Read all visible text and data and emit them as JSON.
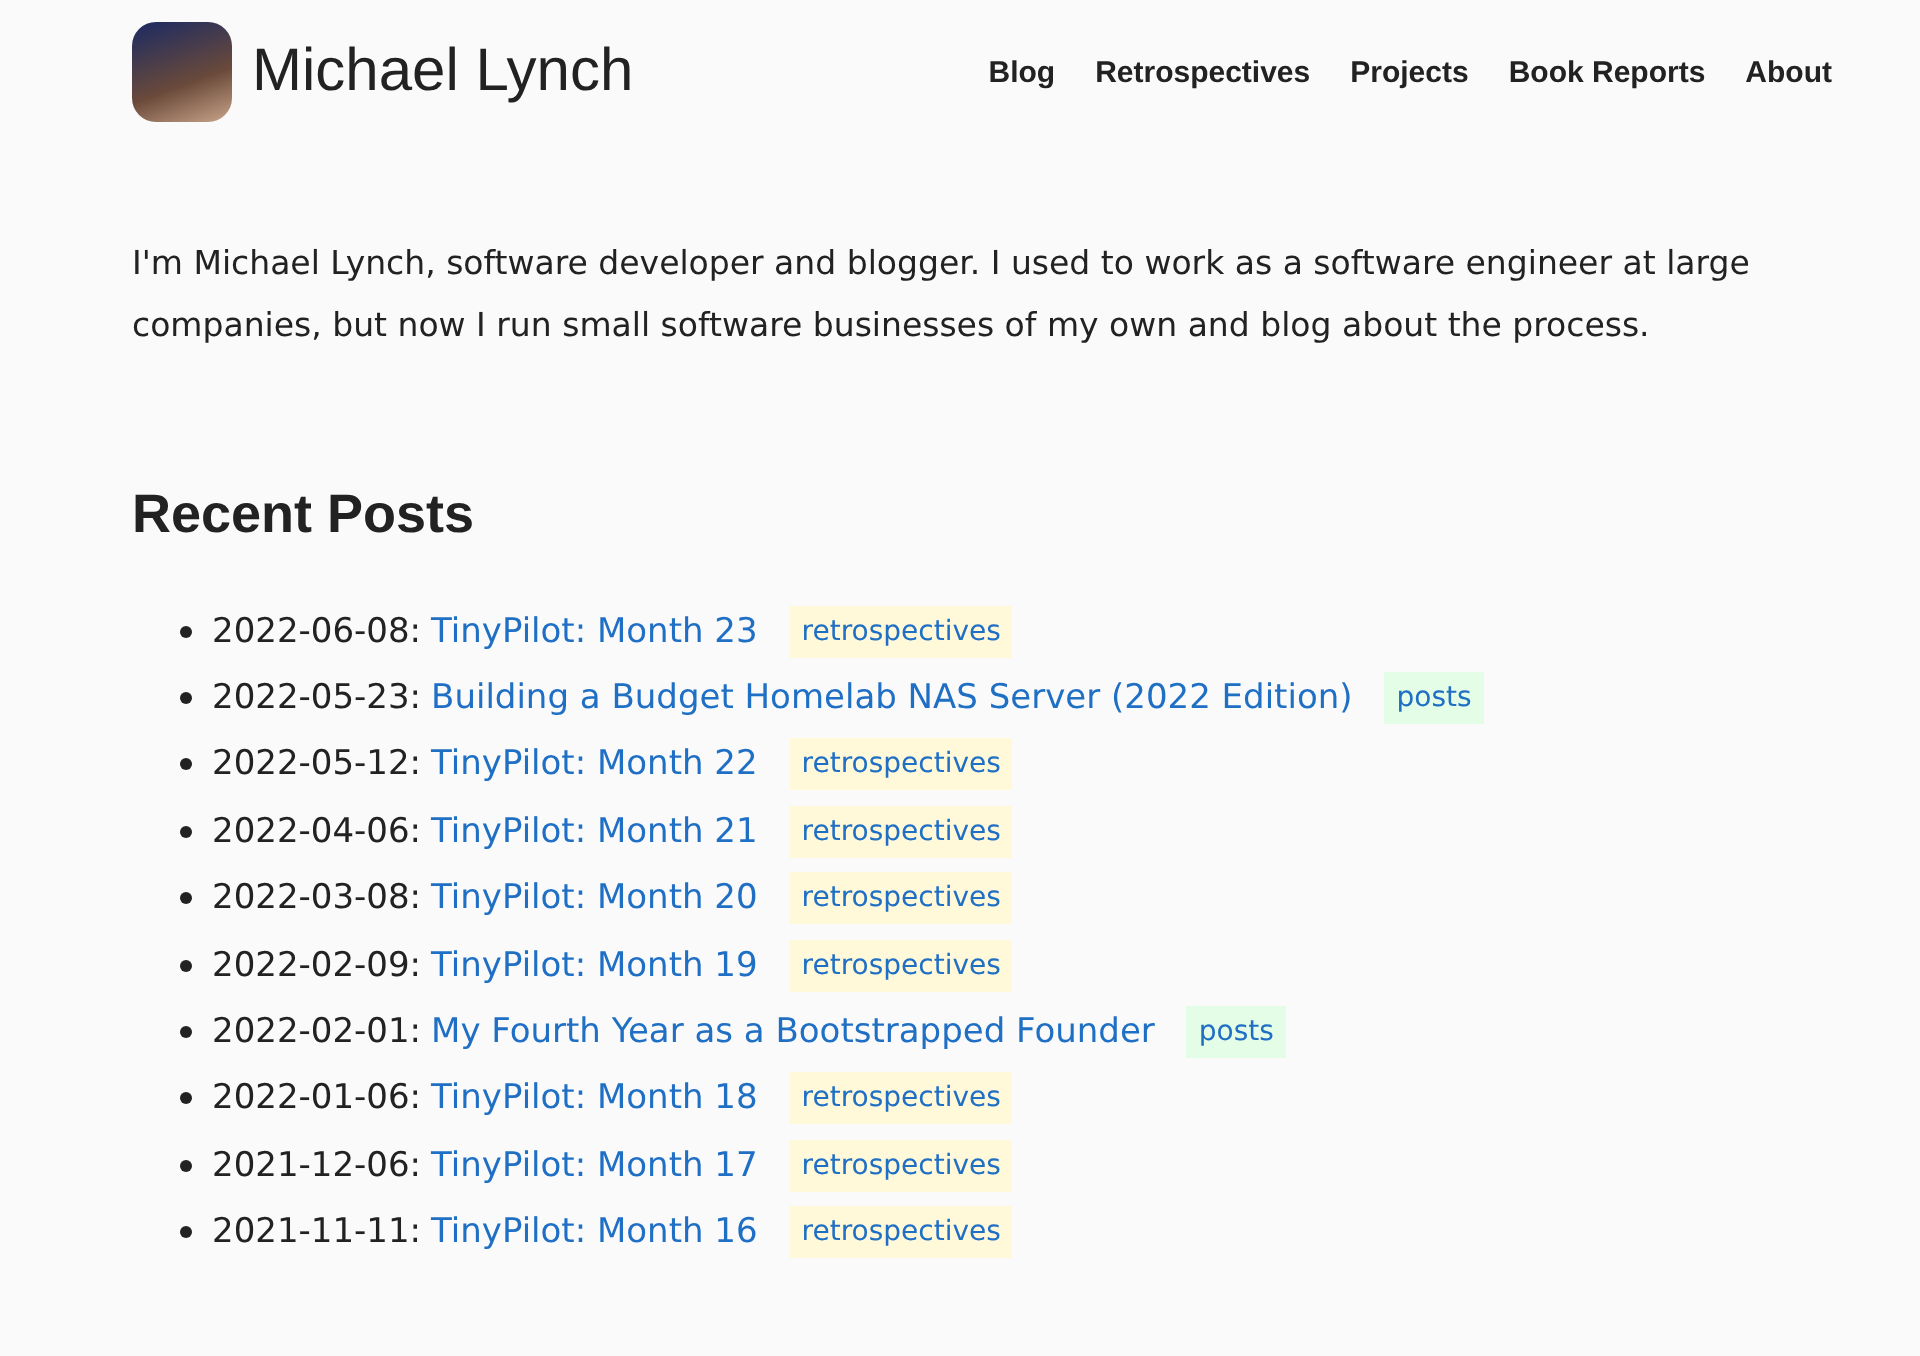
{
  "header": {
    "site_title": "Michael Lynch",
    "nav": [
      {
        "label": "Blog"
      },
      {
        "label": "Retrospectives"
      },
      {
        "label": "Projects"
      },
      {
        "label": "Book Reports"
      },
      {
        "label": "About"
      }
    ]
  },
  "intro": "I'm Michael Lynch, software developer and blogger. I used to work as a software engineer at large companies, but now I run small software businesses of my own and blog about the process.",
  "recent_posts": {
    "heading": "Recent Posts",
    "posts": [
      {
        "date": "2022-06-08:",
        "title": "TinyPilot: Month 23",
        "tag": {
          "label": "retrospectives",
          "color": "#fff8d9"
        }
      },
      {
        "date": "2022-05-23:",
        "title": "Building a Budget Homelab NAS Server (2022 Edition)",
        "tag": {
          "label": "posts",
          "color": "#e3fde6"
        }
      },
      {
        "date": "2022-05-12:",
        "title": "TinyPilot: Month 22",
        "tag": {
          "label": "retrospectives",
          "color": "#fff8d9"
        }
      },
      {
        "date": "2022-04-06:",
        "title": "TinyPilot: Month 21",
        "tag": {
          "label": "retrospectives",
          "color": "#fff8d9"
        }
      },
      {
        "date": "2022-03-08:",
        "title": "TinyPilot: Month 20",
        "tag": {
          "label": "retrospectives",
          "color": "#fff8d9"
        }
      },
      {
        "date": "2022-02-09:",
        "title": "TinyPilot: Month 19",
        "tag": {
          "label": "retrospectives",
          "color": "#fff8d9"
        }
      },
      {
        "date": "2022-02-01:",
        "title": "My Fourth Year as a Bootstrapped Founder",
        "tag": {
          "label": "posts",
          "color": "#e3fde6"
        }
      },
      {
        "date": "2022-01-06:",
        "title": "TinyPilot: Month 18",
        "tag": {
          "label": "retrospectives",
          "color": "#fff8d9"
        }
      },
      {
        "date": "2021-12-06:",
        "title": "TinyPilot: Month 17",
        "tag": {
          "label": "retrospectives",
          "color": "#fff8d9"
        }
      },
      {
        "date": "2021-11-11:",
        "title": "TinyPilot: Month 16",
        "tag": {
          "label": "retrospectives",
          "color": "#fff8d9"
        }
      }
    ]
  }
}
